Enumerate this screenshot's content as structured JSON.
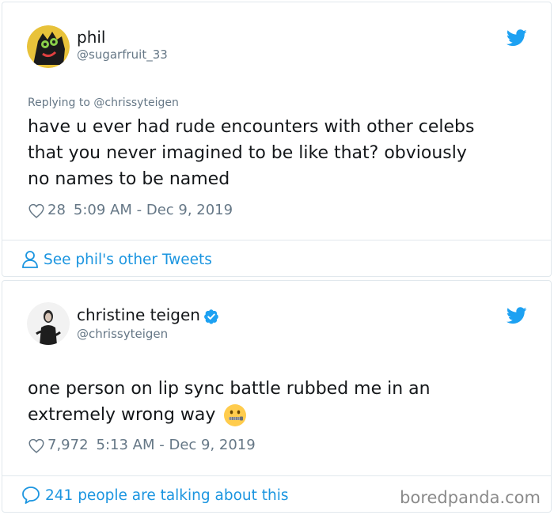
{
  "tweet1": {
    "name": "phil",
    "handle": "@sugarfruit_33",
    "replying_to": "Replying to @chrissyteigen",
    "text_lines": [
      "have u ever had rude encounters with other celebs",
      "that you never imagined to be like that? obviously",
      "no names to be named"
    ],
    "likes": "28",
    "timestamp": "5:09 AM - Dec 9, 2019",
    "footer_link": "See phil's other Tweets"
  },
  "tweet2": {
    "name": "christine teigen",
    "handle": "@chrissyteigen",
    "verified": true,
    "text_lines": [
      "one person on lip sync battle rubbed me in an",
      "extremely wrong way"
    ],
    "emoji": "zipper-mouth-face",
    "likes": "7,972",
    "timestamp": "5:13 AM - Dec 9, 2019",
    "footer_link": "241 people are talking about this"
  },
  "watermark": "boredpanda.com",
  "colors": {
    "twitter_blue": "#1da1f2",
    "link_blue": "#1b95e0",
    "secondary_text": "#657786",
    "border": "#e1e8ed"
  }
}
